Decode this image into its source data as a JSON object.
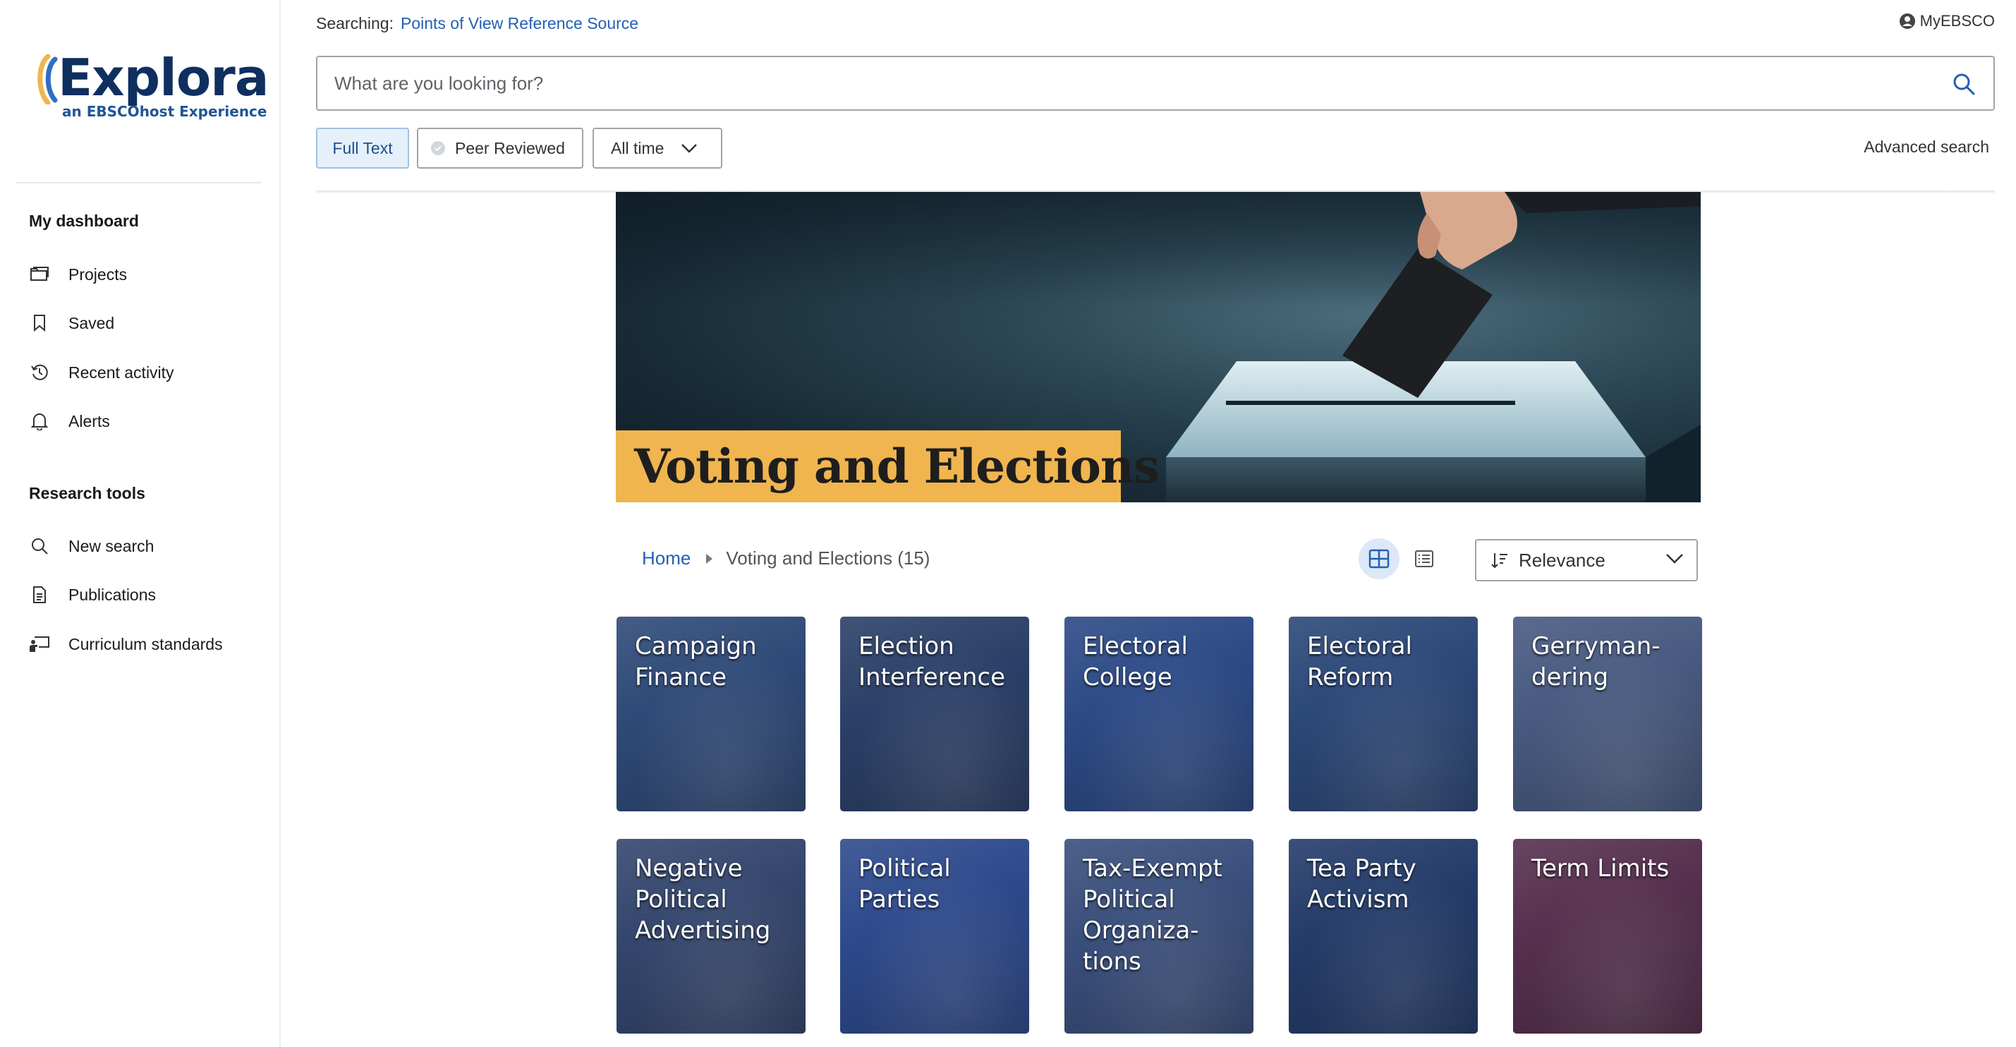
{
  "brand": {
    "name": "Explora",
    "tagline": "an EBSCOhost Experience"
  },
  "sidebar": {
    "dashboard_heading": "My dashboard",
    "dashboard_items": [
      {
        "label": "Projects",
        "icon": "folder-icon"
      },
      {
        "label": "Saved",
        "icon": "bookmark-icon"
      },
      {
        "label": "Recent activity",
        "icon": "history-icon"
      },
      {
        "label": "Alerts",
        "icon": "bell-icon"
      }
    ],
    "tools_heading": "Research tools",
    "tools_items": [
      {
        "label": "New search",
        "icon": "search-icon"
      },
      {
        "label": "Publications",
        "icon": "document-icon"
      },
      {
        "label": "Curriculum standards",
        "icon": "presentation-icon"
      }
    ]
  },
  "header": {
    "searching_label": "Searching:",
    "searching_source": "Points of View Reference Source",
    "account_label": "MyEBSCO",
    "search_placeholder": "What are you looking for?",
    "filters": {
      "full_text": "Full Text",
      "peer_reviewed": "Peer Reviewed",
      "date_range": "All time"
    },
    "advanced_search": "Advanced search"
  },
  "hero": {
    "title": "Voting and Elections"
  },
  "results": {
    "breadcrumb_home": "Home",
    "breadcrumb_current": "Voting and Elections (15)",
    "sort_value": "Relevance",
    "active_view": "grid"
  },
  "topics": [
    {
      "label": "Campaign Finance",
      "color": "#2f4a78"
    },
    {
      "label": "Election Interference",
      "color": "#2b4068"
    },
    {
      "label": "Electoral College",
      "color": "#2d4a86"
    },
    {
      "label": "Electoral Reform",
      "color": "#2c4878"
    },
    {
      "label": "Gerryman-dering",
      "color": "#485a80"
    },
    {
      "label": "Negative Political Advertising",
      "color": "#34466d"
    },
    {
      "label": "Political Parties",
      "color": "#2e4a8c"
    },
    {
      "label": "Tax-Exempt Political Organiza-tions",
      "color": "#3a4f7c"
    },
    {
      "label": "Tea Party Activism",
      "color": "#243c6a"
    },
    {
      "label": "Term Limits",
      "color": "#56304e"
    }
  ],
  "colors": {
    "brand_navy": "#0f2f5f",
    "link_blue": "#2360b5",
    "hero_title_bg": "#f0b54f"
  }
}
